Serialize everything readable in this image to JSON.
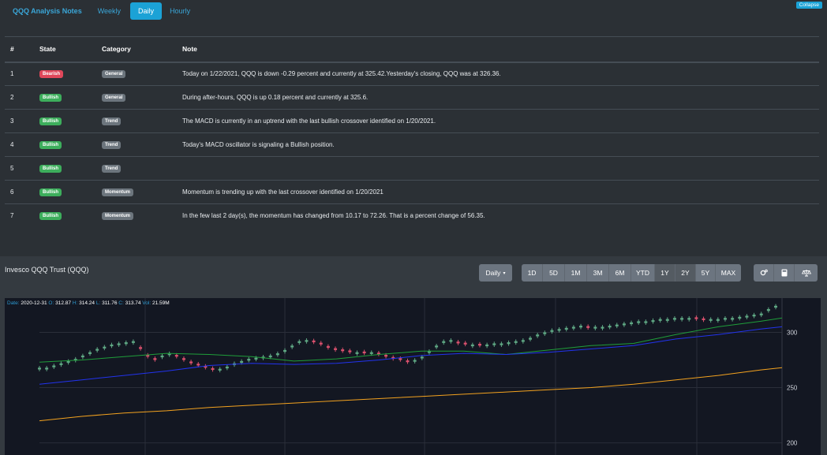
{
  "nav": {
    "brand": "QQQ Analysis Notes",
    "links": [
      "Weekly",
      "Daily",
      "Hourly"
    ],
    "active": "Daily",
    "collapse": "Collapse"
  },
  "table": {
    "headers": [
      "#",
      "State",
      "Category",
      "Note"
    ],
    "rows": [
      {
        "n": "1",
        "state": "Bearish",
        "cat": "General",
        "note": "Today on 1/22/2021, QQQ is down -0.29 percent and currently at 325.42.Yesterday's closing, QQQ was at 326.36."
      },
      {
        "n": "2",
        "state": "Bullish",
        "cat": "General",
        "note": "During after-hours, QQQ is up 0.18 percent and currently at 325.6."
      },
      {
        "n": "3",
        "state": "Bullish",
        "cat": "Trend",
        "note": "The MACD is currently in an uptrend with the last bullish crossover identified on 1/20/2021."
      },
      {
        "n": "4",
        "state": "Bullish",
        "cat": "Trend",
        "note": "Today's MACD oscillator is signaling a Bullish position."
      },
      {
        "n": "5",
        "state": "Bullish",
        "cat": "Trend",
        "note": ""
      },
      {
        "n": "6",
        "state": "Bullish",
        "cat": "Momentum",
        "note": "Momentum is trending up with the last crossover identified on 1/20/2021"
      },
      {
        "n": "7",
        "state": "Bullish",
        "cat": "Momentum",
        "note": "In the few last 2 day(s), the momentum has changed from 10.17 to 72.26. That is a percent change of 56.35."
      }
    ]
  },
  "chart": {
    "title": "Invesco QQQ Trust (QQQ)",
    "interval": "Daily",
    "ranges": [
      "1D",
      "5D",
      "1M",
      "3M",
      "6M",
      "YTD",
      "1Y",
      "2Y",
      "5Y",
      "MAX"
    ],
    "active_ranges": [
      "1Y",
      "2Y"
    ],
    "tool_icons": [
      "settings-icon",
      "calculator-icon",
      "scale-icon"
    ],
    "legend": {
      "date_label": "Date:",
      "date": "2020-12-31",
      "o_label": "O:",
      "o": "312.87",
      "h_label": "H:",
      "h": "314.24",
      "l_label": "L:",
      "l": "311.76",
      "c_label": "C:",
      "c": "313.74",
      "vol_label": "Vol:",
      "vol": "21.59M"
    },
    "colors": {
      "up": "#5fa884",
      "down": "#d9506d",
      "ma_short": "#1f9e3a",
      "ma_mid": "#2233ee",
      "ma_long": "#f3a21f",
      "bg": "#131722"
    }
  },
  "chart_data": {
    "type": "line",
    "yticks": [
      300,
      250,
      200
    ],
    "ylim": [
      189,
      331
    ],
    "x": [
      0,
      10,
      20,
      30,
      40,
      50,
      60,
      70,
      80,
      90,
      100,
      110,
      120,
      130,
      140,
      150,
      160,
      170,
      175
    ],
    "candles": [
      268,
      268,
      270,
      272,
      274,
      276,
      279,
      282,
      285,
      287,
      289,
      290,
      291,
      292,
      285,
      278,
      275,
      279,
      281,
      278,
      275,
      272,
      270,
      268,
      266,
      267,
      269,
      272,
      274,
      276,
      277,
      278,
      279,
      281,
      284,
      288,
      292,
      293,
      291,
      289,
      286,
      284,
      283,
      282,
      282,
      281,
      282,
      280,
      278,
      276,
      275,
      273,
      275,
      278,
      283,
      288,
      292,
      293,
      290,
      289,
      289,
      288,
      289,
      290,
      290,
      291,
      292,
      293,
      295,
      298,
      300,
      302,
      303,
      304,
      305,
      306,
      304,
      305,
      305,
      306,
      307,
      308,
      309,
      310,
      310,
      311,
      312,
      312,
      313,
      313,
      313,
      312,
      311,
      312,
      312,
      313,
      313,
      314,
      315,
      316,
      317,
      321,
      324
    ],
    "series": [
      {
        "values": [
          273,
          275,
          278,
          281,
          280,
          278,
          274,
          276,
          280,
          283,
          283,
          280,
          284,
          288,
          290,
          298,
          305,
          310,
          313
        ]
      },
      {
        "values": [
          253,
          257,
          261,
          265,
          270,
          272,
          271,
          272,
          275,
          279,
          281,
          280,
          282,
          285,
          288,
          294,
          298,
          303,
          305
        ]
      },
      {
        "values": [
          220,
          224,
          227,
          229,
          232,
          234,
          236,
          238,
          240,
          242,
          244,
          246,
          248,
          250,
          253,
          257,
          261,
          266,
          268
        ]
      }
    ]
  }
}
